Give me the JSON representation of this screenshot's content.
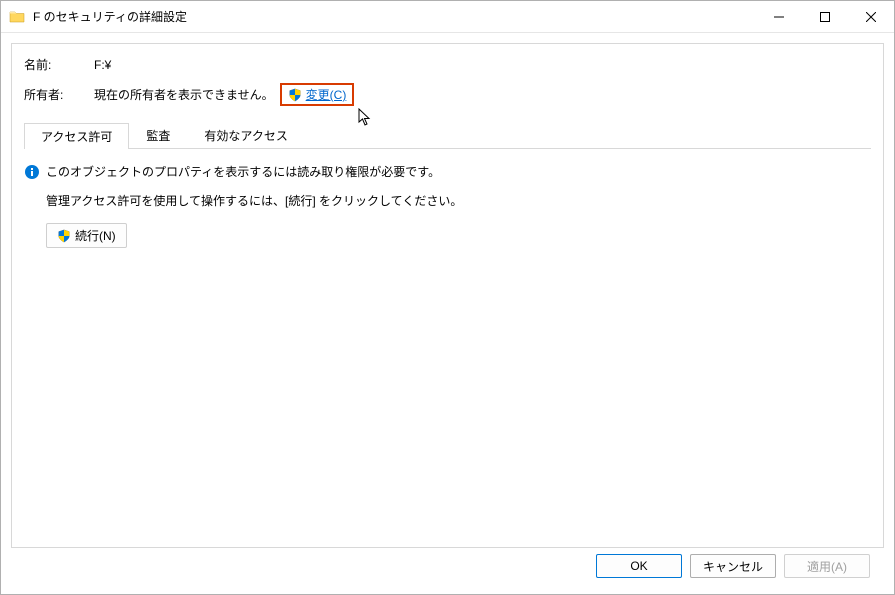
{
  "titlebar": {
    "title": "F のセキュリティの詳細設定"
  },
  "fields": {
    "name_label": "名前:",
    "name_value": "F:¥",
    "owner_label": "所有者:",
    "owner_value": "現在の所有者を表示できません。",
    "change_link": "変更(C)"
  },
  "tabs": {
    "permissions": "アクセス許可",
    "auditing": "監査",
    "effective": "有効なアクセス"
  },
  "content": {
    "info_text": "このオブジェクトのプロパティを表示するには読み取り権限が必要です。",
    "instruction": "管理アクセス許可を使用して操作するには、[続行] をクリックしてください。",
    "continue_button": "続行(N)"
  },
  "footer": {
    "ok": "OK",
    "cancel": "キャンセル",
    "apply": "適用(A)"
  }
}
